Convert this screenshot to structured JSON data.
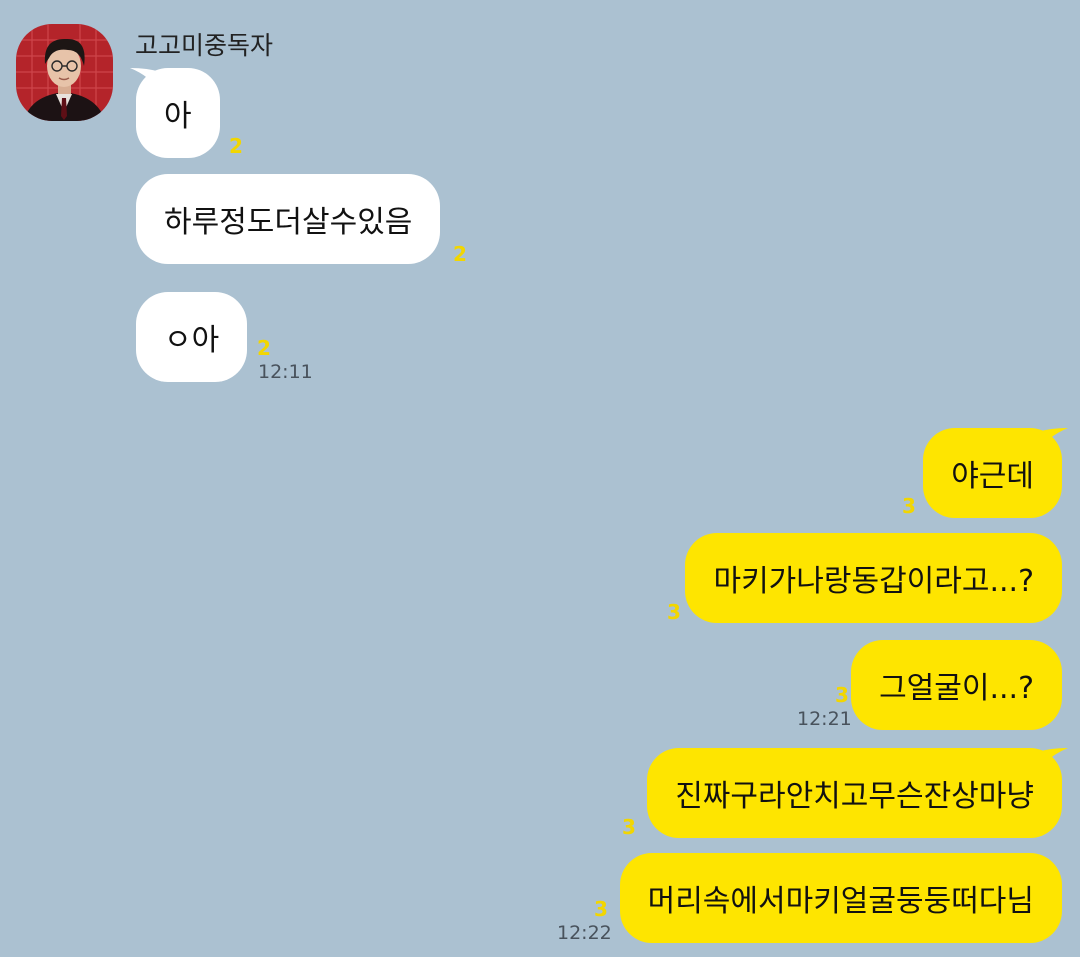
{
  "chat": {
    "sender_name": "고고미중독자",
    "incoming": [
      {
        "text": "아",
        "unread": "2"
      },
      {
        "text": "하루정도더살수있음",
        "unread": "2"
      },
      {
        "text": "ㅇ아",
        "unread": "2",
        "time": "12:11"
      }
    ],
    "outgoing": [
      {
        "text": "야근데",
        "unread": "3"
      },
      {
        "text": "마키가나랑동갑이라고...?",
        "unread": "3"
      },
      {
        "text": "그얼굴이...?",
        "unread": "3",
        "time": "12:21"
      },
      {
        "text": "진짜구라안치고무슨잔상마냥",
        "unread": "3"
      },
      {
        "text": "머리속에서마키얼굴둥둥떠다님",
        "unread": "3",
        "time": "12:22"
      }
    ]
  },
  "colors": {
    "background": "#abc1d1",
    "incoming_bubble": "#ffffff",
    "outgoing_bubble": "#fee500",
    "unread_count": "#f2d600",
    "timestamp": "#48525c"
  }
}
